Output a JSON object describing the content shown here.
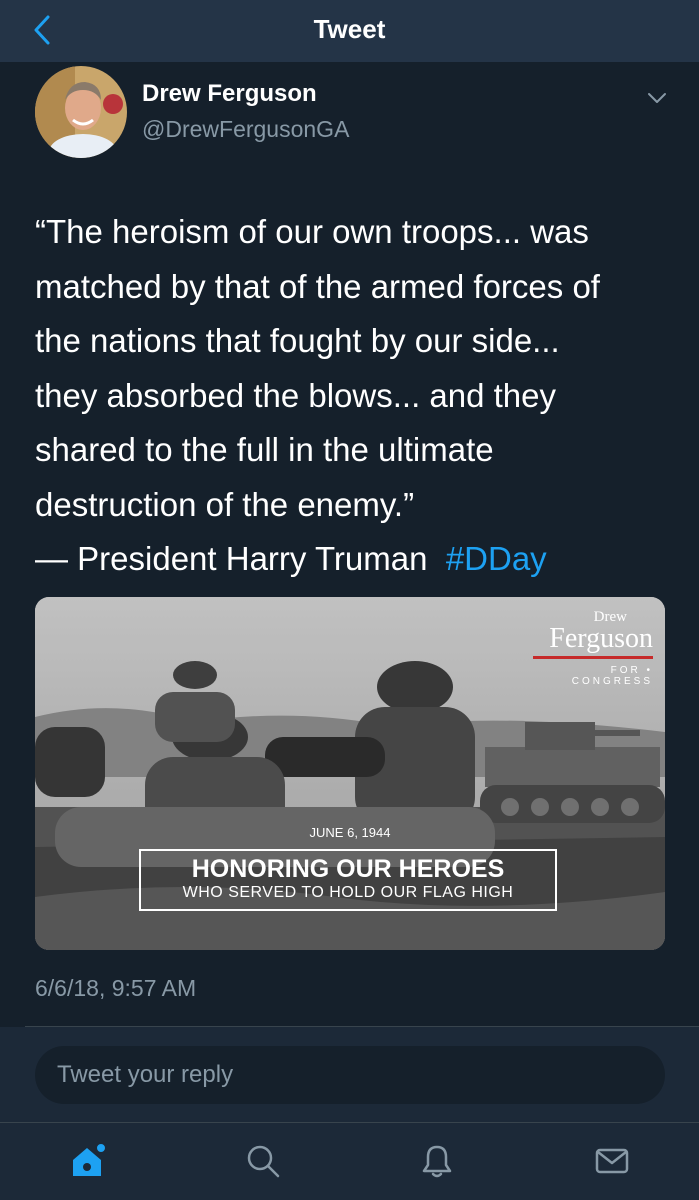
{
  "header": {
    "title": "Tweet",
    "back_icon": "chevron-left-icon"
  },
  "author": {
    "name": "Drew Ferguson",
    "handle": "@DrewFergusonGA"
  },
  "tweet": {
    "lines": [
      "“The heroism of our own troops... was",
      "matched by that of the armed forces of",
      "the nations that fought by our side...",
      "they absorbed the blows... and they",
      "shared to the full in the ultimate",
      "destruction of the enemy.”"
    ],
    "attribution": "— President Harry Truman",
    "hashtag": "#DDay",
    "timestamp": "6/6/18, 9:57 AM"
  },
  "media": {
    "brand_first": "Drew",
    "brand_last": "Ferguson",
    "brand_sub": "FOR • CONGRESS",
    "date": "JUNE 6, 1944",
    "headline": "HONORING OUR HEROES",
    "subline": "WHO SERVED TO HOLD OUR FLAG HIGH"
  },
  "reply": {
    "placeholder": "Tweet your reply"
  },
  "tabs": [
    "home-icon",
    "search-icon",
    "notifications-icon",
    "messages-icon"
  ],
  "colors": {
    "accent": "#1da1f2",
    "background": "#15202b",
    "bar": "#243447",
    "muted": "#8899a6"
  }
}
